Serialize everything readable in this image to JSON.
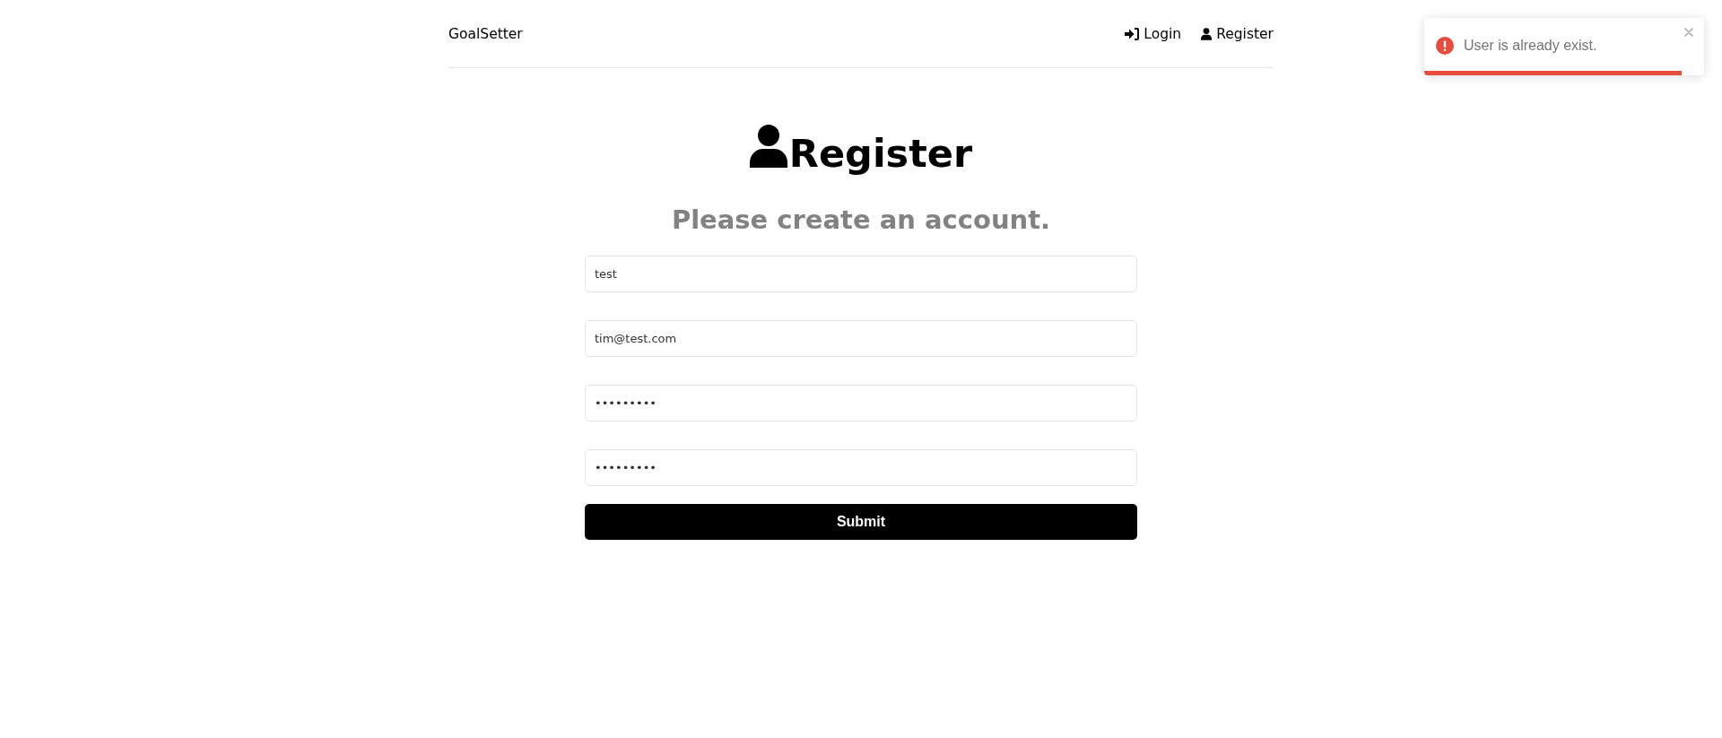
{
  "header": {
    "brand": "GoalSetter",
    "nav": [
      {
        "label": "Login",
        "kind": "login"
      },
      {
        "label": "Register",
        "kind": "register"
      }
    ]
  },
  "heading": {
    "title": "Register",
    "subtitle": "Please create an account."
  },
  "form": {
    "fields": [
      {
        "value": "test"
      },
      {
        "value": "tim@test.com"
      },
      {
        "value": "•••••••••"
      },
      {
        "value": "•••••••••"
      }
    ],
    "submit": "Submit"
  },
  "toast": {
    "message": "User is already exist.",
    "level": 0.92
  }
}
